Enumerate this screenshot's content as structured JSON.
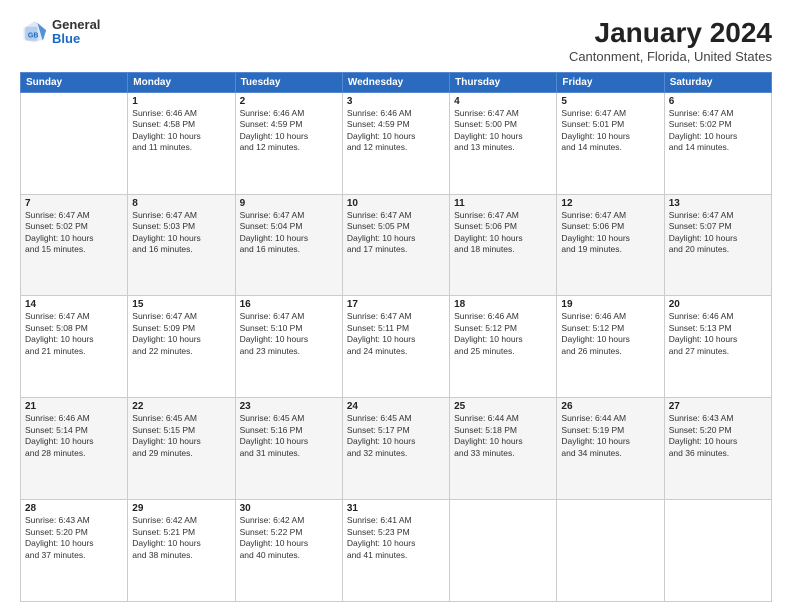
{
  "logo": {
    "general": "General",
    "blue": "Blue"
  },
  "title": "January 2024",
  "subtitle": "Cantonment, Florida, United States",
  "days_of_week": [
    "Sunday",
    "Monday",
    "Tuesday",
    "Wednesday",
    "Thursday",
    "Friday",
    "Saturday"
  ],
  "weeks": [
    [
      {
        "day": "",
        "info": ""
      },
      {
        "day": "1",
        "info": "Sunrise: 6:46 AM\nSunset: 4:58 PM\nDaylight: 10 hours\nand 11 minutes."
      },
      {
        "day": "2",
        "info": "Sunrise: 6:46 AM\nSunset: 4:59 PM\nDaylight: 10 hours\nand 12 minutes."
      },
      {
        "day": "3",
        "info": "Sunrise: 6:46 AM\nSunset: 4:59 PM\nDaylight: 10 hours\nand 12 minutes."
      },
      {
        "day": "4",
        "info": "Sunrise: 6:47 AM\nSunset: 5:00 PM\nDaylight: 10 hours\nand 13 minutes."
      },
      {
        "day": "5",
        "info": "Sunrise: 6:47 AM\nSunset: 5:01 PM\nDaylight: 10 hours\nand 14 minutes."
      },
      {
        "day": "6",
        "info": "Sunrise: 6:47 AM\nSunset: 5:02 PM\nDaylight: 10 hours\nand 14 minutes."
      }
    ],
    [
      {
        "day": "7",
        "info": "Sunrise: 6:47 AM\nSunset: 5:02 PM\nDaylight: 10 hours\nand 15 minutes."
      },
      {
        "day": "8",
        "info": "Sunrise: 6:47 AM\nSunset: 5:03 PM\nDaylight: 10 hours\nand 16 minutes."
      },
      {
        "day": "9",
        "info": "Sunrise: 6:47 AM\nSunset: 5:04 PM\nDaylight: 10 hours\nand 16 minutes."
      },
      {
        "day": "10",
        "info": "Sunrise: 6:47 AM\nSunset: 5:05 PM\nDaylight: 10 hours\nand 17 minutes."
      },
      {
        "day": "11",
        "info": "Sunrise: 6:47 AM\nSunset: 5:06 PM\nDaylight: 10 hours\nand 18 minutes."
      },
      {
        "day": "12",
        "info": "Sunrise: 6:47 AM\nSunset: 5:06 PM\nDaylight: 10 hours\nand 19 minutes."
      },
      {
        "day": "13",
        "info": "Sunrise: 6:47 AM\nSunset: 5:07 PM\nDaylight: 10 hours\nand 20 minutes."
      }
    ],
    [
      {
        "day": "14",
        "info": "Sunrise: 6:47 AM\nSunset: 5:08 PM\nDaylight: 10 hours\nand 21 minutes."
      },
      {
        "day": "15",
        "info": "Sunrise: 6:47 AM\nSunset: 5:09 PM\nDaylight: 10 hours\nand 22 minutes."
      },
      {
        "day": "16",
        "info": "Sunrise: 6:47 AM\nSunset: 5:10 PM\nDaylight: 10 hours\nand 23 minutes."
      },
      {
        "day": "17",
        "info": "Sunrise: 6:47 AM\nSunset: 5:11 PM\nDaylight: 10 hours\nand 24 minutes."
      },
      {
        "day": "18",
        "info": "Sunrise: 6:46 AM\nSunset: 5:12 PM\nDaylight: 10 hours\nand 25 minutes."
      },
      {
        "day": "19",
        "info": "Sunrise: 6:46 AM\nSunset: 5:12 PM\nDaylight: 10 hours\nand 26 minutes."
      },
      {
        "day": "20",
        "info": "Sunrise: 6:46 AM\nSunset: 5:13 PM\nDaylight: 10 hours\nand 27 minutes."
      }
    ],
    [
      {
        "day": "21",
        "info": "Sunrise: 6:46 AM\nSunset: 5:14 PM\nDaylight: 10 hours\nand 28 minutes."
      },
      {
        "day": "22",
        "info": "Sunrise: 6:45 AM\nSunset: 5:15 PM\nDaylight: 10 hours\nand 29 minutes."
      },
      {
        "day": "23",
        "info": "Sunrise: 6:45 AM\nSunset: 5:16 PM\nDaylight: 10 hours\nand 31 minutes."
      },
      {
        "day": "24",
        "info": "Sunrise: 6:45 AM\nSunset: 5:17 PM\nDaylight: 10 hours\nand 32 minutes."
      },
      {
        "day": "25",
        "info": "Sunrise: 6:44 AM\nSunset: 5:18 PM\nDaylight: 10 hours\nand 33 minutes."
      },
      {
        "day": "26",
        "info": "Sunrise: 6:44 AM\nSunset: 5:19 PM\nDaylight: 10 hours\nand 34 minutes."
      },
      {
        "day": "27",
        "info": "Sunrise: 6:43 AM\nSunset: 5:20 PM\nDaylight: 10 hours\nand 36 minutes."
      }
    ],
    [
      {
        "day": "28",
        "info": "Sunrise: 6:43 AM\nSunset: 5:20 PM\nDaylight: 10 hours\nand 37 minutes."
      },
      {
        "day": "29",
        "info": "Sunrise: 6:42 AM\nSunset: 5:21 PM\nDaylight: 10 hours\nand 38 minutes."
      },
      {
        "day": "30",
        "info": "Sunrise: 6:42 AM\nSunset: 5:22 PM\nDaylight: 10 hours\nand 40 minutes."
      },
      {
        "day": "31",
        "info": "Sunrise: 6:41 AM\nSunset: 5:23 PM\nDaylight: 10 hours\nand 41 minutes."
      },
      {
        "day": "",
        "info": ""
      },
      {
        "day": "",
        "info": ""
      },
      {
        "day": "",
        "info": ""
      }
    ]
  ]
}
